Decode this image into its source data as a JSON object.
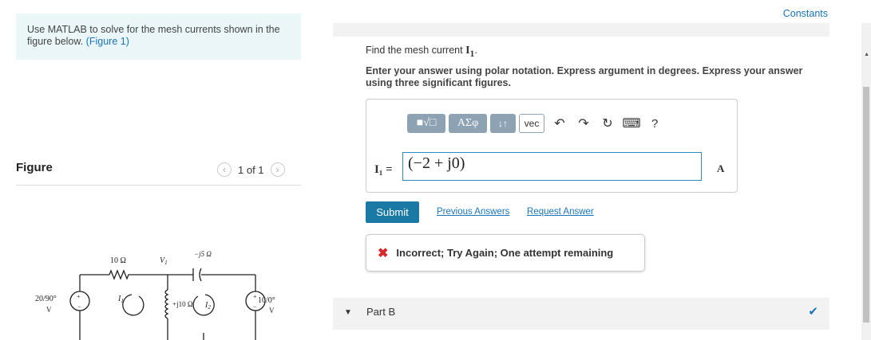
{
  "intro": {
    "text": "Use MATLAB to solve for the mesh currents shown in the figure below.",
    "link": "(Figure 1)"
  },
  "figure": {
    "heading": "Figure",
    "pager": "1 of 1",
    "circuit": {
      "r1": "10 Ω",
      "v1": "V",
      "v1_sub": "1",
      "xc": "−j5 Ω",
      "src_left": "20/90°",
      "src_left_unit": "V",
      "i1": "I",
      "i1_sub": "1",
      "xl": "+j10 Ω",
      "i2": "I",
      "i2_sub": "2",
      "src_right": "10/0°",
      "src_right_unit": "V",
      "plus": "+",
      "minus": "−"
    }
  },
  "constants_link": "Constants",
  "question": {
    "text": "Find the mesh current",
    "var": "I",
    "var_sub": "1",
    "period": ".",
    "instructions": "Enter your answer using polar notation. Express argument in degrees. Express your answer using three significant figures."
  },
  "toolbar": {
    "sqrt": "■√□",
    "greek": "ΑΣφ",
    "arrows": "↓↑",
    "vec": "vec",
    "undo": "↶",
    "redo": "↷",
    "reset": "↻",
    "keyboard": "⌨",
    "help": "?"
  },
  "answer": {
    "label": "I₁ =",
    "value": "(−2 + j0)",
    "unit": "A"
  },
  "submit_label": "Submit",
  "previous_answers": "Previous Answers",
  "request_answer": "Request Answer",
  "feedback": {
    "icon": "✖",
    "text": "Incorrect; Try Again; One attempt remaining"
  },
  "part_b": {
    "label": "Part B",
    "check": "✔"
  },
  "colors": {
    "accent": "#1b75bb",
    "submit": "#1a7aa5",
    "error": "#d9262b",
    "intro_bg": "#eaf6f8"
  }
}
